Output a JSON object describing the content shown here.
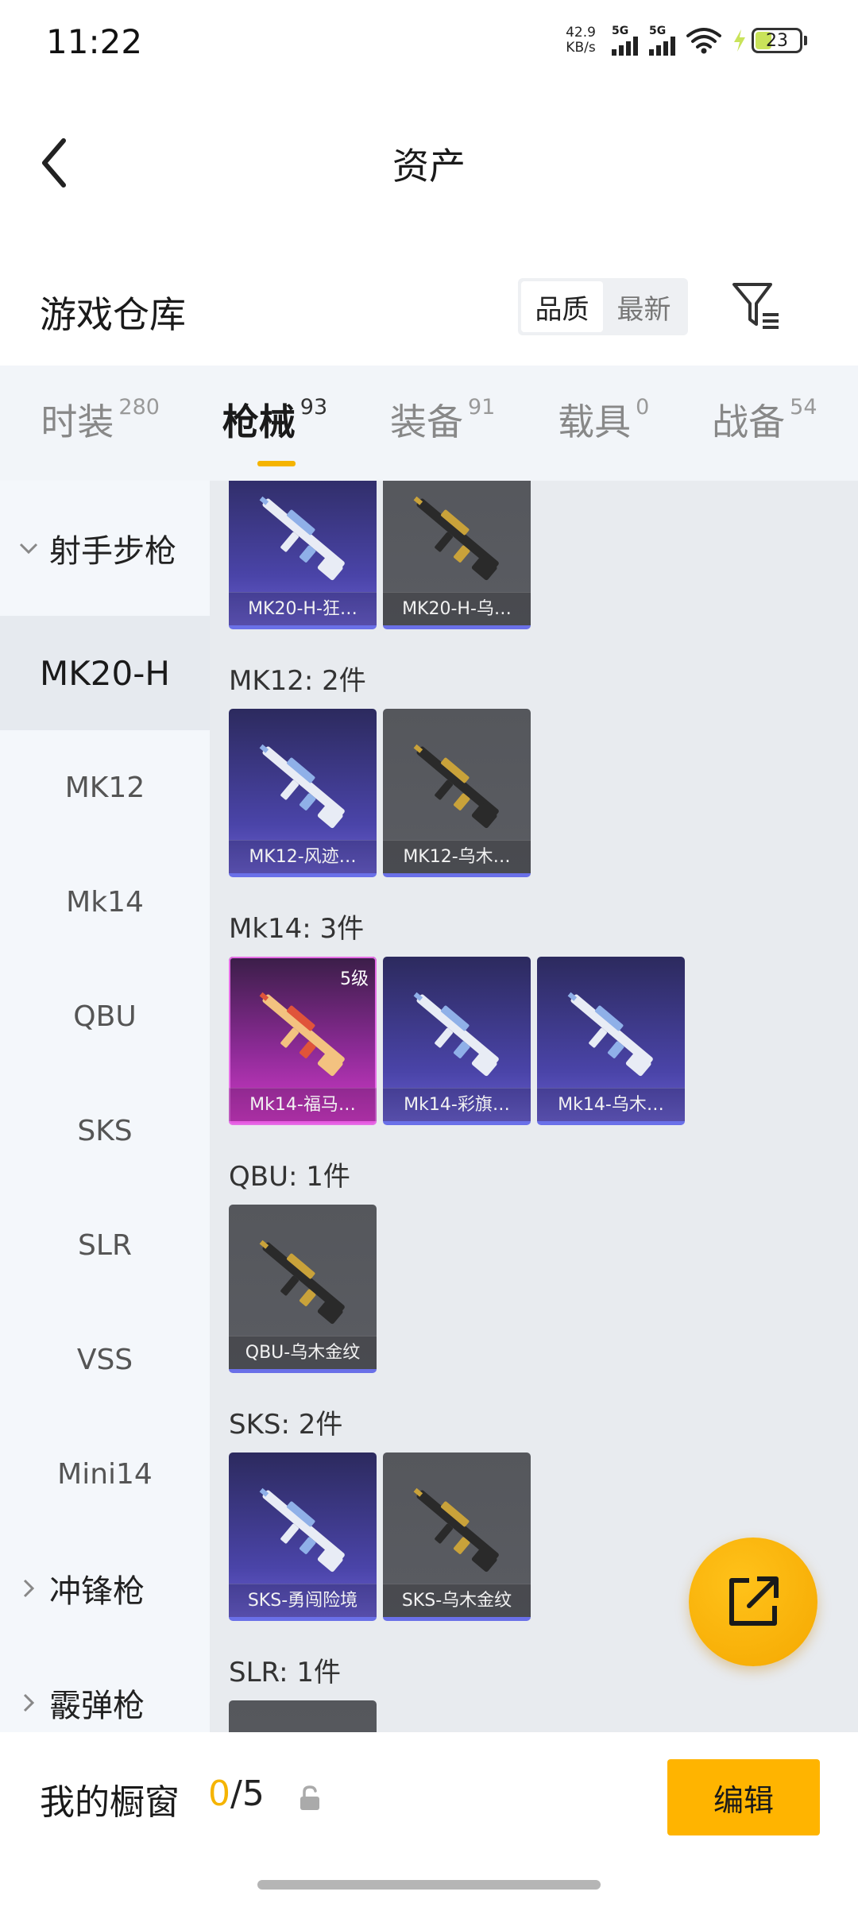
{
  "status_bar": {
    "time": "11:22",
    "net_speed_value": "42.9",
    "net_speed_unit": "KB/s",
    "signal_1": "5G",
    "signal_2": "5G",
    "battery": "23"
  },
  "header": {
    "title": "资产"
  },
  "warehouse": {
    "title": "游戏仓库",
    "sort_options": [
      "品质",
      "最新"
    ],
    "sort_selected": "品质"
  },
  "tabs": [
    {
      "label": "时装",
      "count": "280",
      "active": false
    },
    {
      "label": "枪械",
      "count": "93",
      "active": true
    },
    {
      "label": "装备",
      "count": "91",
      "active": false
    },
    {
      "label": "载具",
      "count": "0",
      "active": false
    },
    {
      "label": "战备",
      "count": "54",
      "active": false
    }
  ],
  "sidebar": {
    "group_expanded": "射手步枪",
    "items": [
      "MK20-H",
      "MK12",
      "Mk14",
      "QBU",
      "SKS",
      "SLR",
      "VSS",
      "Mini14"
    ],
    "selected": "MK20-H",
    "groups_collapsed": [
      "冲锋枪",
      "霰弹枪"
    ]
  },
  "sections": [
    {
      "title": "",
      "items": [
        {
          "label": "MK20-H-狂…",
          "rarity": "purple"
        },
        {
          "label": "MK20-H-乌…",
          "rarity": "gray"
        }
      ]
    },
    {
      "title": "MK12: 2件",
      "items": [
        {
          "label": "MK12-风迹…",
          "rarity": "purple"
        },
        {
          "label": "MK12-乌木…",
          "rarity": "gray"
        }
      ]
    },
    {
      "title": "Mk14: 3件",
      "items": [
        {
          "label": "Mk14-福马…",
          "rarity": "pink",
          "level": "5级"
        },
        {
          "label": "Mk14-彩旗…",
          "rarity": "purple"
        },
        {
          "label": "Mk14-乌木…",
          "rarity": "purple"
        }
      ]
    },
    {
      "title": "QBU: 1件",
      "items": [
        {
          "label": "QBU-乌木金纹",
          "rarity": "gray"
        }
      ]
    },
    {
      "title": "SKS: 2件",
      "items": [
        {
          "label": "SKS-勇闯险境",
          "rarity": "purple"
        },
        {
          "label": "SKS-乌木金纹",
          "rarity": "gray"
        }
      ]
    },
    {
      "title": "SLR: 1件",
      "items": [
        {
          "label": "",
          "rarity": "gray"
        }
      ]
    }
  ],
  "bottom_bar": {
    "showcase_label": "我的橱窗",
    "count_current": "0",
    "count_total": "/5",
    "edit_label": "编辑"
  }
}
